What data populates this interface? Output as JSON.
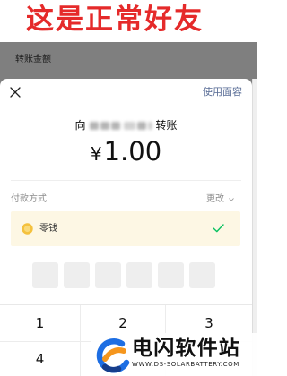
{
  "page": {
    "heading": "这是正常好友"
  },
  "background_page": {
    "title": "转账金额"
  },
  "sheet": {
    "face_id_label": "使用面容",
    "transfer_prefix": "向",
    "transfer_suffix": "转账",
    "currency_symbol": "¥",
    "amount": "1.00",
    "payment_method_label": "付款方式",
    "change_label": "更改",
    "selected_method": {
      "label": "零钱",
      "selected": true
    },
    "pin_digits": [
      "",
      "",
      "",
      "",
      "",
      ""
    ]
  },
  "keypad": {
    "keys": [
      "1",
      "2",
      "3",
      "4"
    ]
  },
  "watermark": {
    "name": "电闪软件站",
    "url": "WWW.DS-SOLARBATTERY.COM"
  },
  "icons": {
    "close": "close-icon",
    "change": "chevron-down-icon",
    "method": "coin-icon",
    "selected": "checkmark-icon",
    "logo": "logo-mark-icon"
  },
  "colors": {
    "heading": "#e52a2a",
    "overlay": "#7f7f7f",
    "link": "#576b95",
    "selected_bg": "#fdf7e4",
    "coin": "#f4c13d",
    "coin_inner": "#f9da7a",
    "check": "#07c160",
    "logo_blue": "#1d6ee3",
    "logo_orange": "#f5961d",
    "logo_navy": "#163e8c"
  }
}
